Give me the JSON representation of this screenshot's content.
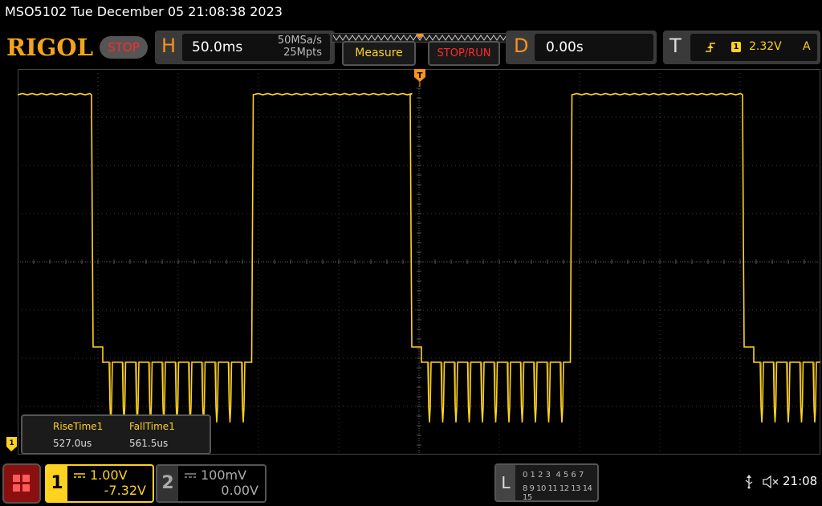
{
  "header": {
    "title": "MSO5102  Tue December 05 21:08:38 2023",
    "logo": "RIGOL",
    "run_state": "STOP"
  },
  "horizontal": {
    "letter": "H",
    "timebase": "50.0ms",
    "sample_rate": "50MSa/s",
    "memory_depth": "25Mpts"
  },
  "buttons": {
    "measure": "Measure",
    "stop_run": "STOP/RUN"
  },
  "delay": {
    "letter": "D",
    "value": "0.00s"
  },
  "trigger": {
    "letter": "T",
    "channel": "1",
    "level": "2.32V",
    "mode": "A"
  },
  "measurements": {
    "items": [
      {
        "label": "RiseTime1",
        "value": "527.0us"
      },
      {
        "label": "FallTime1",
        "value": "561.5us"
      }
    ]
  },
  "channels": [
    {
      "number": "1",
      "scale": "1.00V",
      "offset": "-7.32V",
      "active": true
    },
    {
      "number": "2",
      "scale": "100mV",
      "offset": "0.00V",
      "active": false
    }
  ],
  "logic": {
    "letter": "L",
    "row1": "0 1 2 3  4 5 6 7",
    "row2": "8 9 10 11 12 13 14 15"
  },
  "status": {
    "clock": "21:08"
  },
  "markers": {
    "ch1_ground": "1",
    "trigger_pos": "T"
  },
  "colors": {
    "channel1": "#ffd21f",
    "channel2": "#5f5f5f",
    "accent_orange": "#f7941d",
    "stop_red": "#ff2b2b",
    "grid": "#3c3c3c",
    "background": "#000000"
  }
}
